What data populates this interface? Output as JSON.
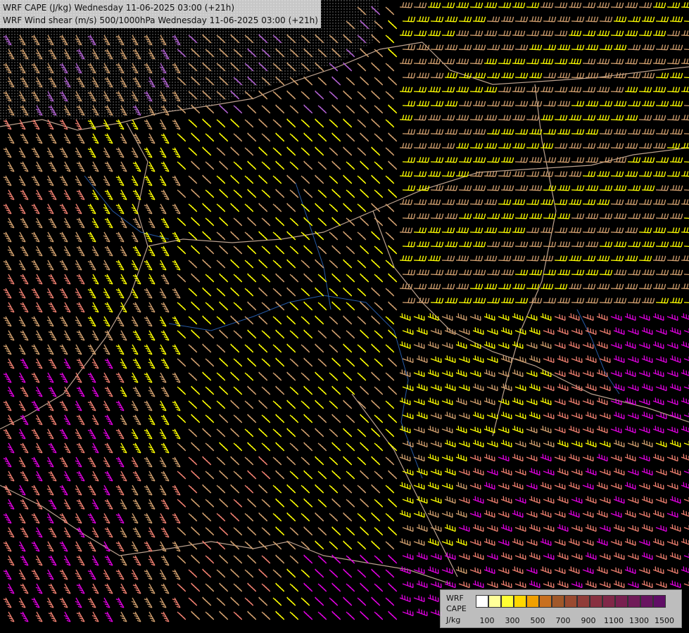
{
  "title": {
    "line1": "WRF CAPE (J/kg) Wednesday 11-06-2025 03:00 (+21h)",
    "line2": "WRF Wind shear (m/s) 500/1000hPa Wednesday 11-06-2025 03:00 (+21h)"
  },
  "legend": {
    "label_model": "WRF",
    "label_var": "CAPE",
    "label_unit": "J/kg",
    "colors": [
      "#ffffff",
      "#ffff99",
      "#ffff33",
      "#ffd700",
      "#f0a000",
      "#c87020",
      "#a0582a",
      "#9a4a30",
      "#903c38",
      "#883040",
      "#802848",
      "#782050",
      "#701a58",
      "#681460",
      "#600e66"
    ],
    "tick_labels": [
      "100",
      "300",
      "500",
      "700",
      "900",
      "1100",
      "1300",
      "1500"
    ]
  },
  "layers": {
    "barb_colors": {
      "tan": "#d2a06e",
      "yellow": "#ffff00",
      "salmon": "#f08070",
      "magenta": "#e000e0",
      "violet": "#b060d0"
    },
    "border_color": "#e8c8b0",
    "river_color": "#3070d0"
  }
}
